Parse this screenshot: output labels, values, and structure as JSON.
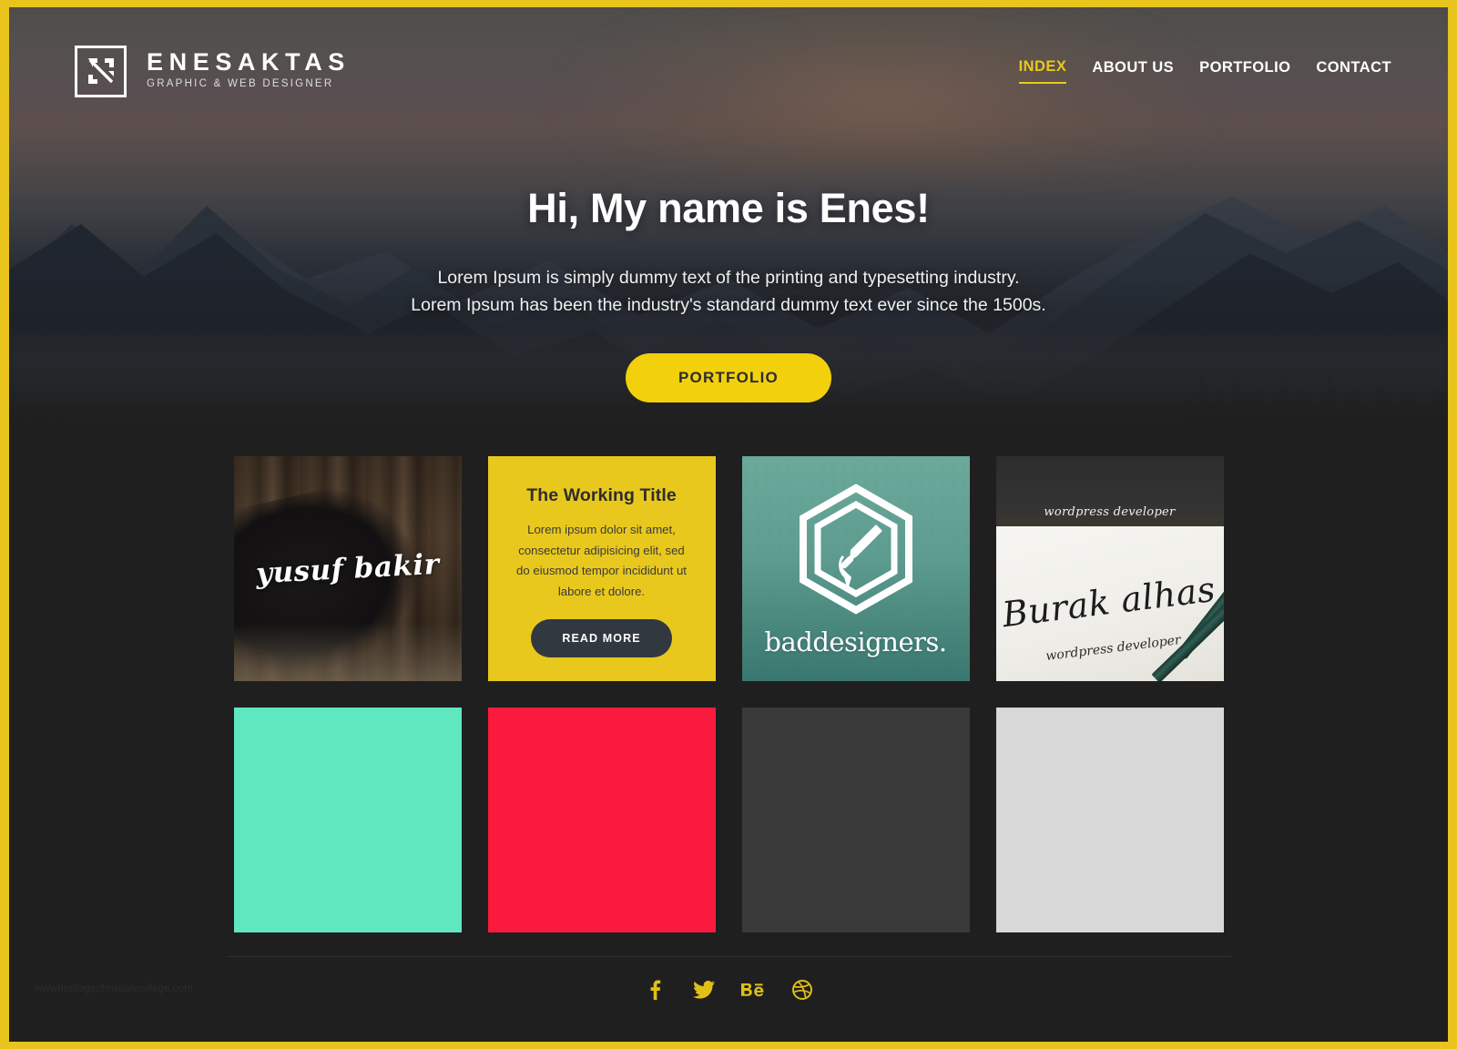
{
  "site": {
    "frame_color": "#e8c41c",
    "background": "#1f1f1f",
    "accent": "#e9c81d"
  },
  "brand": {
    "mark_icon": "monogram-logo-icon",
    "name": "ENESAKTAS",
    "tagline": "GRAPHIC & WEB DESIGNER"
  },
  "nav": {
    "items": [
      {
        "label": "INDEX",
        "active": true
      },
      {
        "label": "ABOUT US",
        "active": false
      },
      {
        "label": "PORTFOLIO",
        "active": false
      },
      {
        "label": "CONTACT",
        "active": false
      }
    ]
  },
  "hero": {
    "title": "Hi, My name is Enes!",
    "subtitle_line1": "Lorem Ipsum is simply dummy text of the printing and typesetting industry.",
    "subtitle_line2": "Lorem Ipsum has been the industry's standard dummy text ever since the 1500s.",
    "cta_label": "PORTFOLIO",
    "cta_color": "#f2d00c",
    "cta_text_color": "#2c2c2c"
  },
  "portfolio": {
    "tiles": [
      {
        "type": "image",
        "name": "guitar-logo-tile",
        "logo_text": "yusuf bakir",
        "subject": "acoustic guitar on wooden floor"
      },
      {
        "type": "card",
        "name": "working-title-card",
        "background": "#e9c81d",
        "title": "The Working Title",
        "body": "Lorem ipsum dolor sit amet, consectetur adipisicing elit, sed do eiusmod tempor incididunt ut labore et dolore.",
        "button_label": "READ MORE",
        "button_color": "#323840"
      },
      {
        "type": "image",
        "name": "baddesigners-tile",
        "logo_text": "baddesigners.",
        "background": "#6ea99c",
        "subject": "hexagon badge with hand holding pen over forest"
      },
      {
        "type": "image",
        "name": "burak-alhas-tile",
        "top_caption": "wordpress developer",
        "logo_text": "Burak alhas",
        "role_text": "wordpress developer",
        "subject": "calligraphy on paper with pencils"
      }
    ],
    "swatches": [
      {
        "name": "swatch-mint",
        "color": "#5FE8C0"
      },
      {
        "name": "swatch-crimson",
        "color": "#FA1A3E"
      },
      {
        "name": "swatch-charcoal",
        "color": "#3A3A3A"
      },
      {
        "name": "swatch-lightgray",
        "color": "#D8D8D8"
      }
    ]
  },
  "footer": {
    "social": [
      {
        "name": "facebook-icon",
        "glyph": "f",
        "label": "Facebook"
      },
      {
        "name": "twitter-icon",
        "glyph": "🐦",
        "label": "Twitter"
      },
      {
        "name": "behance-icon",
        "glyph": "Bē",
        "label": "Behance"
      },
      {
        "name": "dribbble-icon",
        "glyph": "◉",
        "label": "Dribbble"
      }
    ],
    "social_color": "#e0bf16",
    "watermark": "wwwheritagechristiancollege.com"
  }
}
